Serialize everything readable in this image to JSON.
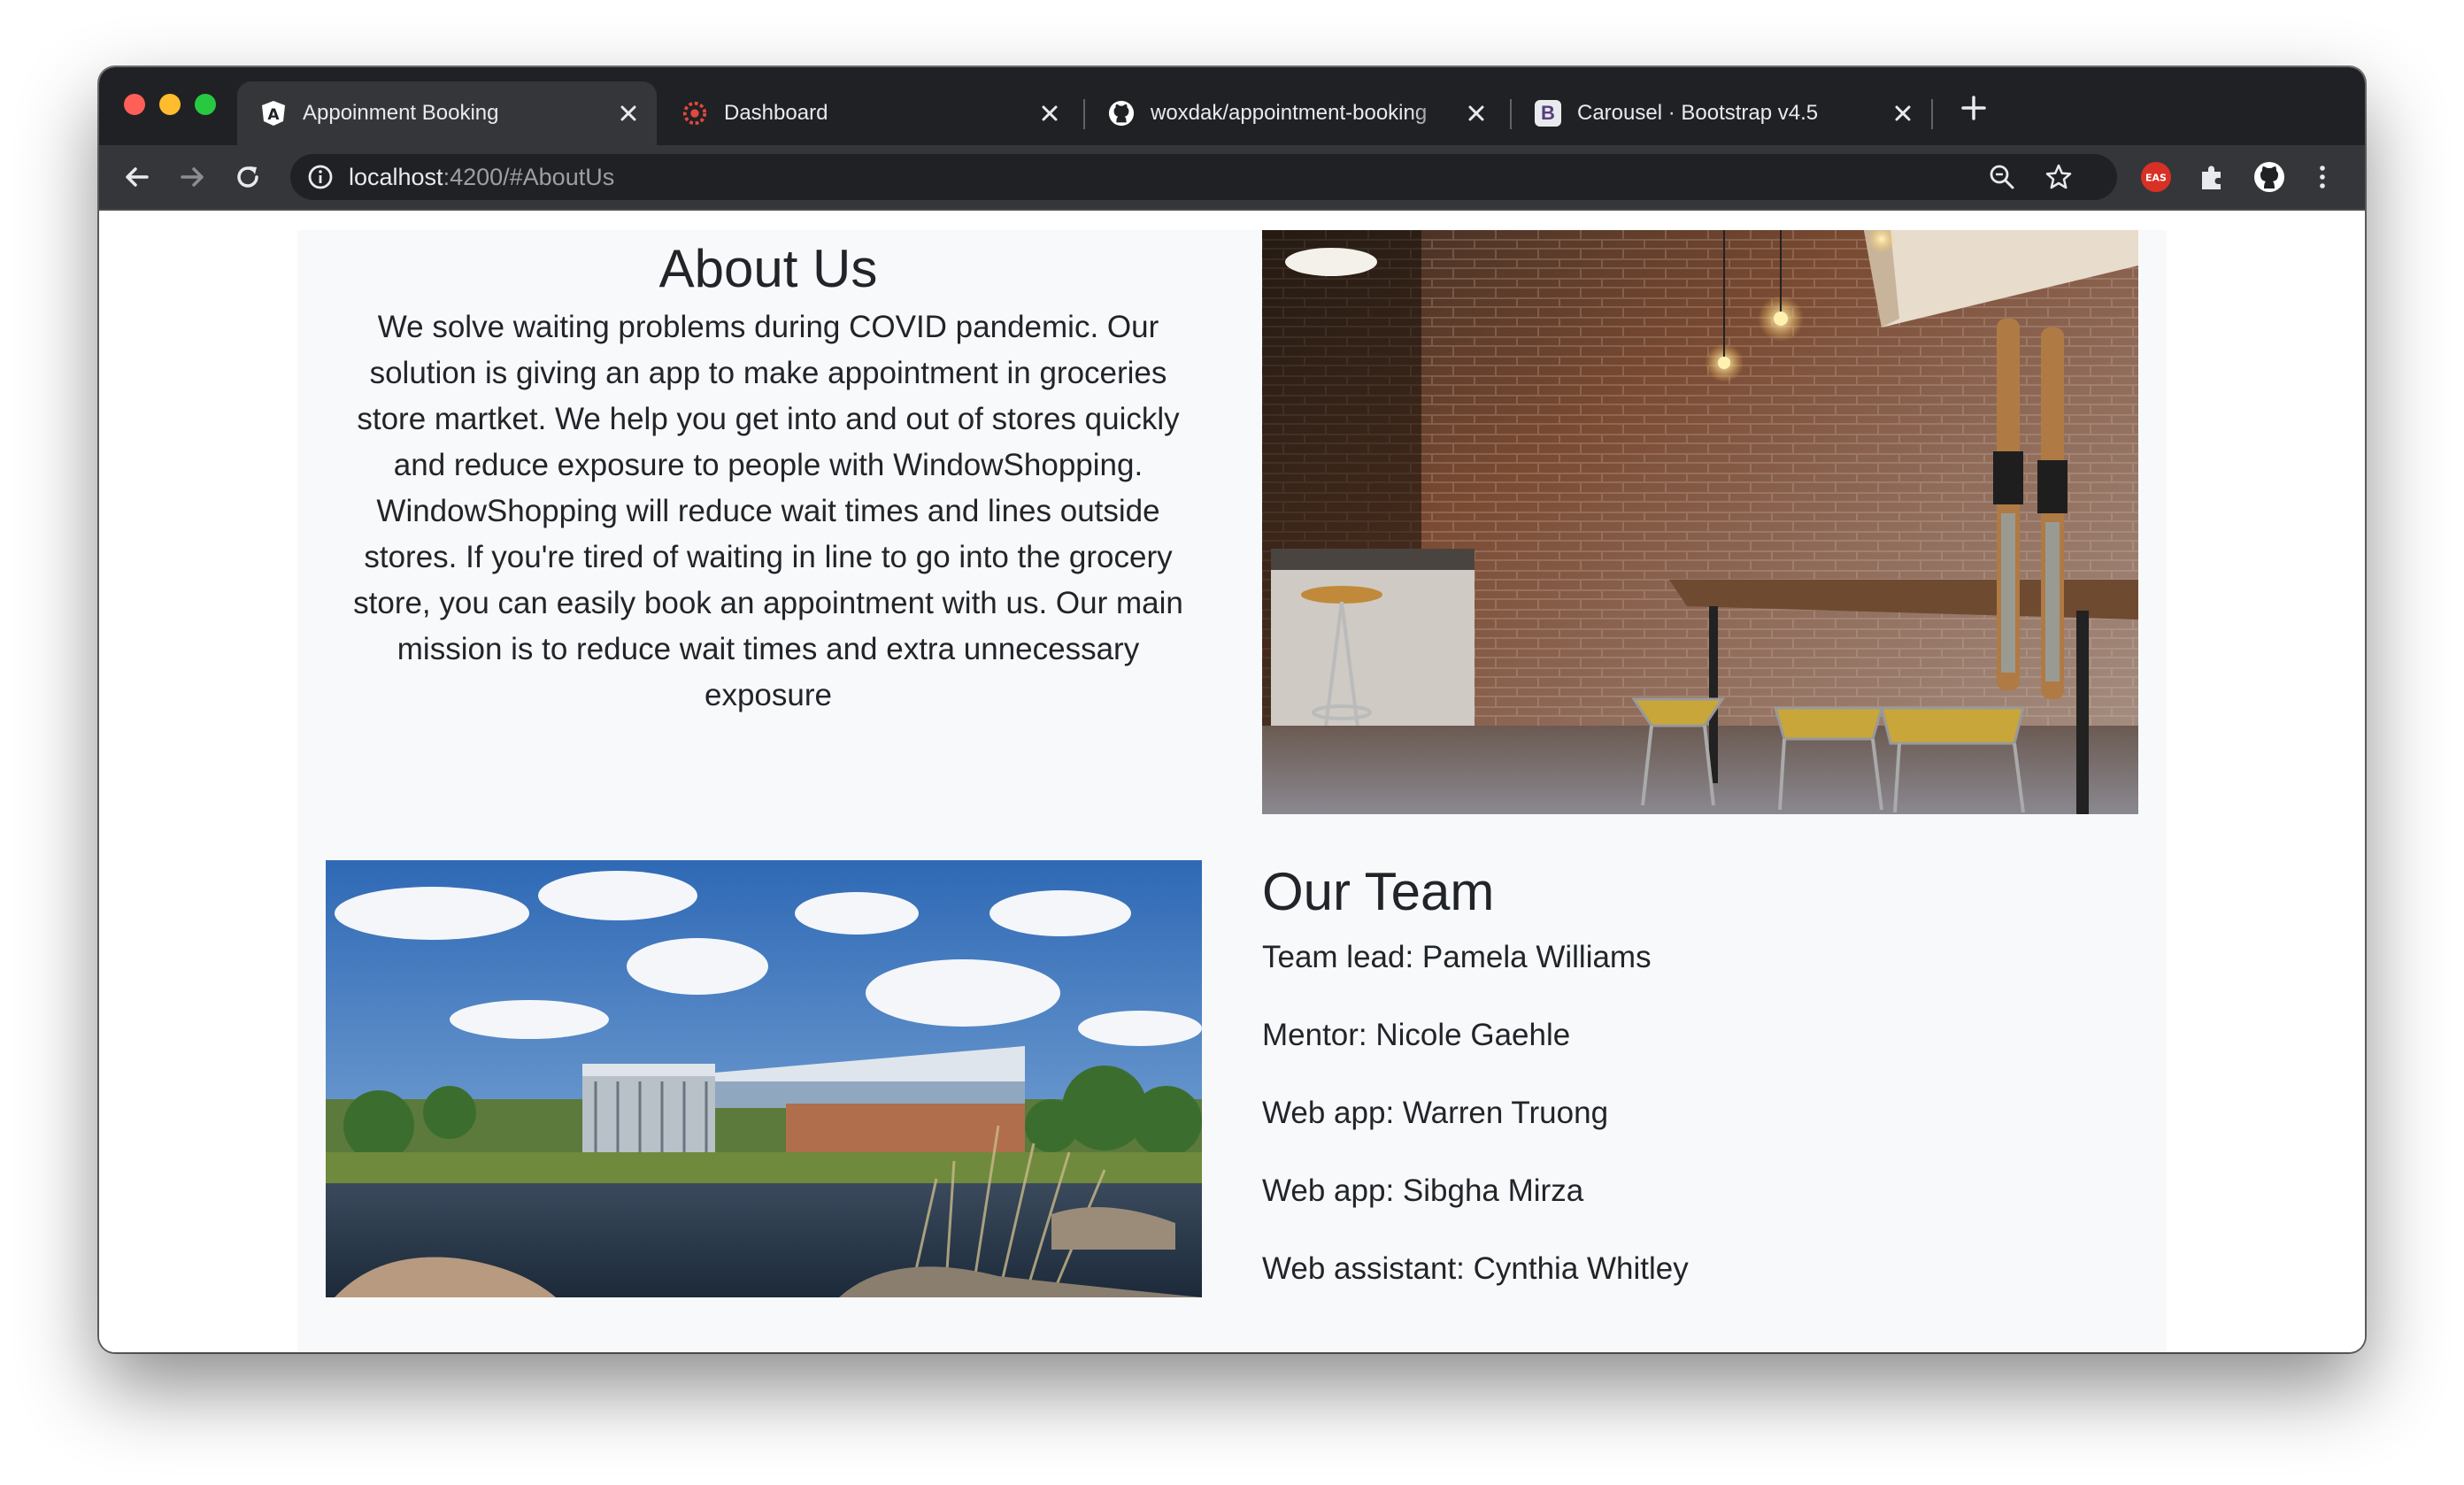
{
  "browser": {
    "tabs": [
      {
        "label": "Appoinment Booking",
        "favicon": "angular-icon",
        "active": true
      },
      {
        "label": "Dashboard",
        "favicon": "dashboard-gear-icon",
        "active": false
      },
      {
        "label": "woxdak/appointment-booking",
        "favicon": "github-icon",
        "active": false
      },
      {
        "label": "Carousel · Bootstrap v4.5",
        "favicon": "bootstrap-icon",
        "active": false
      }
    ],
    "bootstrap_favicon_letter": "B",
    "angular_favicon_letter": "A",
    "url_host": "localhost",
    "url_rest": ":4200/#AboutUs",
    "extension_badge": "EAS"
  },
  "about": {
    "title": "About Us",
    "text": "We solve waiting problems during COVID pandemic. Our solution is giving an app to make appointment in groceries store martket. We help you get into and out of stores quickly and reduce exposure to people with WindowShopping. WindowShopping will reduce wait times and lines outside stores. If you're tired of waiting in line to go into the grocery store, you can easily book an appointment with us. Our main mission is to reduce wait times and extra unnecessary exposure"
  },
  "team": {
    "title": "Our Team",
    "members": [
      "Team lead: Pamela Williams",
      "Mentor: Nicole Gaehle",
      "Web app: Warren Truong",
      "Web app: Sibgha Mirza",
      "Web assistant: Cynthia Whitley"
    ]
  },
  "colors": {
    "tabstrip": "#202124",
    "toolbar": "#35363a",
    "container_bg": "#f8f9fa",
    "text": "#212529"
  }
}
